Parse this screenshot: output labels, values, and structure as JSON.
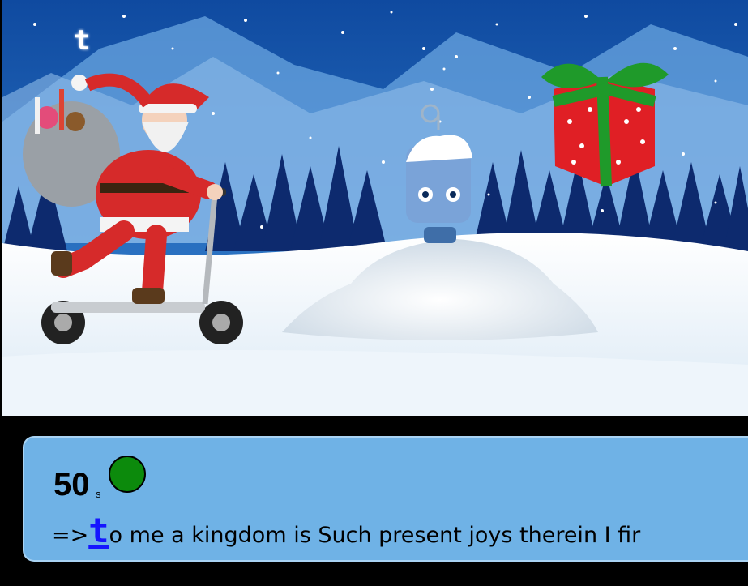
{
  "game": {
    "typed_letter": "t",
    "timer_value": "50",
    "timer_unit": "s",
    "status_color": "#0c8a0c",
    "prompt_arrow": "=>",
    "current_letter": "t",
    "remaining_text": "o me a kingdom is Such present joys therein I fir"
  },
  "scene": {
    "characters": [
      "santa-on-scooter",
      "snow-robot",
      "gift-box"
    ],
    "colors": {
      "sky": "#1c5fb0",
      "snow": "#f2f7fb",
      "trees": "#0d2a6e",
      "gift": "#e01f25",
      "ribbon": "#1f9a2a",
      "santa": "#d62a2a"
    }
  }
}
